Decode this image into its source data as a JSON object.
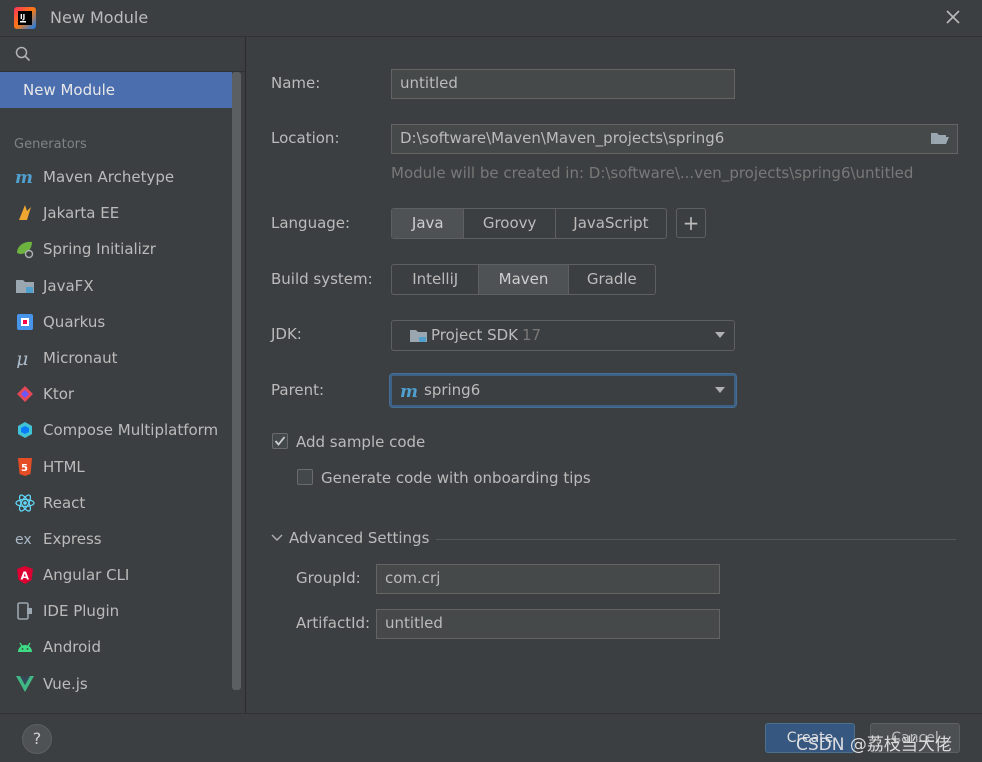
{
  "window": {
    "title": "New Module",
    "close_icon": "close-icon"
  },
  "sidebar": {
    "selected_item": "New Module",
    "generators_header": "Generators",
    "items": [
      {
        "label": "Maven Archetype",
        "icon": "maven-icon",
        "color": "#4f9fcf"
      },
      {
        "label": "Jakarta EE",
        "icon": "jakarta-icon",
        "color": "#f0a732"
      },
      {
        "label": "Spring Initializr",
        "icon": "spring-icon",
        "color": "#6db33f"
      },
      {
        "label": "JavaFX",
        "icon": "javafx-folder-icon",
        "color": "#9aa7b0"
      },
      {
        "label": "Quarkus",
        "icon": "quarkus-icon",
        "color": "#4695eb"
      },
      {
        "label": "Micronaut",
        "icon": "micronaut-icon",
        "color": "#a9b7c6"
      },
      {
        "label": "Ktor",
        "icon": "ktor-icon",
        "color": "#e44857"
      },
      {
        "label": "Compose Multiplatform",
        "icon": "compose-icon",
        "color": "#41c3d6"
      },
      {
        "label": "HTML",
        "icon": "html5-icon",
        "color": "#e44d26"
      },
      {
        "label": "React",
        "icon": "react-icon",
        "color": "#61dafb"
      },
      {
        "label": "Express",
        "icon": "express-icon",
        "color": "#a9b7c6"
      },
      {
        "label": "Angular CLI",
        "icon": "angular-icon",
        "color": "#dd0031"
      },
      {
        "label": "IDE Plugin",
        "icon": "plugin-icon",
        "color": "#9aa7b0"
      },
      {
        "label": "Android",
        "icon": "android-icon",
        "color": "#3ddc84"
      },
      {
        "label": "Vue.js",
        "icon": "vue-icon",
        "color": "#41b883"
      }
    ]
  },
  "form": {
    "name_label": "Name:",
    "name_value": "untitled",
    "location_label": "Location:",
    "location_value": "D:\\software\\Maven\\Maven_projects\\spring6",
    "location_hint": "Module will be created in: D:\\software\\...ven_projects\\spring6\\untitled",
    "language_label": "Language:",
    "languages": [
      "Java",
      "Groovy",
      "JavaScript"
    ],
    "language_selected": "Java",
    "add_language": "+",
    "build_label": "Build system:",
    "build_systems": [
      "IntelliJ",
      "Maven",
      "Gradle"
    ],
    "build_selected": "Maven",
    "jdk_label": "JDK:",
    "jdk_value": "Project SDK",
    "jdk_version": "17",
    "parent_label": "Parent:",
    "parent_value": "spring6",
    "sample_code_label": "Add sample code",
    "sample_code_checked": true,
    "onboarding_label": "Generate code with onboarding tips",
    "onboarding_checked": false,
    "advanced_header": "Advanced Settings",
    "groupid_label": "GroupId:",
    "groupid_value": "com.crj",
    "artifactid_label": "ArtifactId:",
    "artifactid_value": "untitled"
  },
  "footer": {
    "help": "?",
    "create_label": "Create",
    "cancel_label": "Cancel",
    "watermark": "CSDN @荔枝当大佬"
  },
  "colors": {
    "background": "#3c3f41",
    "selection": "#4b6eaf",
    "field": "#45494a",
    "focus_border": "#3d6185",
    "accent_maven": "#4f9fcf"
  }
}
